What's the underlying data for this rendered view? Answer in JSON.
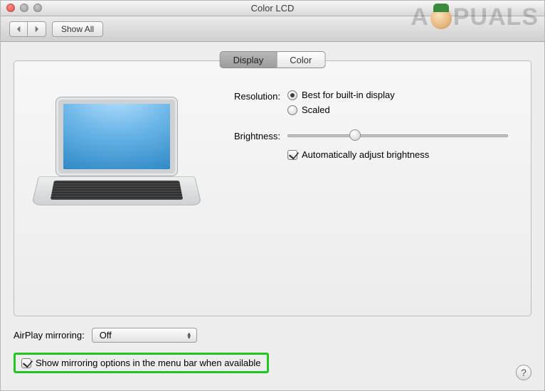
{
  "window": {
    "title": "Color LCD"
  },
  "toolbar": {
    "show_all": "Show All"
  },
  "tabs": {
    "display": "Display",
    "color": "Color"
  },
  "resolution": {
    "label": "Resolution:",
    "best": "Best for built-in display",
    "scaled": "Scaled"
  },
  "brightness": {
    "label": "Brightness:",
    "auto": "Automatically adjust brightness"
  },
  "airplay": {
    "label": "AirPlay mirroring:",
    "value": "Off"
  },
  "mirroring_checkbox": "Show mirroring options in the menu bar when available",
  "help": "?",
  "watermark": {
    "pre": "A",
    "post": "PUALS"
  }
}
